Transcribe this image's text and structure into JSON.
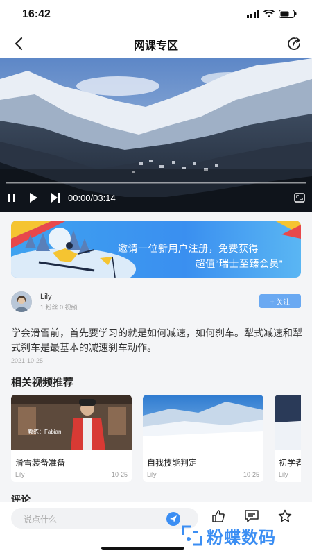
{
  "status_bar": {
    "time": "16:42"
  },
  "nav": {
    "title": "网课专区"
  },
  "video": {
    "time": "00:00/03:14",
    "progress": 0.0
  },
  "banner": {
    "line1": "邀请一位新用户注册，免费获得",
    "line2": "超值“瑞士至臻会员”"
  },
  "author": {
    "name": "Lily",
    "stats": "1 粉丝 0 视频",
    "follow_label": "+ 关注"
  },
  "post": {
    "description": "学会滑雪前，首先要学习的就是如何减速，如何刹车。犁式减速和犁式刹车是最基本的减速刹车动作。",
    "date": "2021-10-25"
  },
  "related": {
    "title": "相关视频推荐",
    "items": [
      {
        "title": "滑雪装备准备",
        "author": "Lily",
        "date": "10-25",
        "caption": "教练：Fabian"
      },
      {
        "title": "自我技能判定",
        "author": "Lily",
        "date": "10-25"
      },
      {
        "title": "初学者",
        "author": "Lily",
        "date": ""
      }
    ]
  },
  "comments": {
    "title": "评论"
  },
  "bottom_bar": {
    "placeholder": "说点什么"
  },
  "watermark": {
    "text": "粉蝶数码"
  },
  "colors": {
    "accent": "#3b8ef3",
    "follow": "#6aa9f2",
    "background": "#f4f5f7"
  }
}
